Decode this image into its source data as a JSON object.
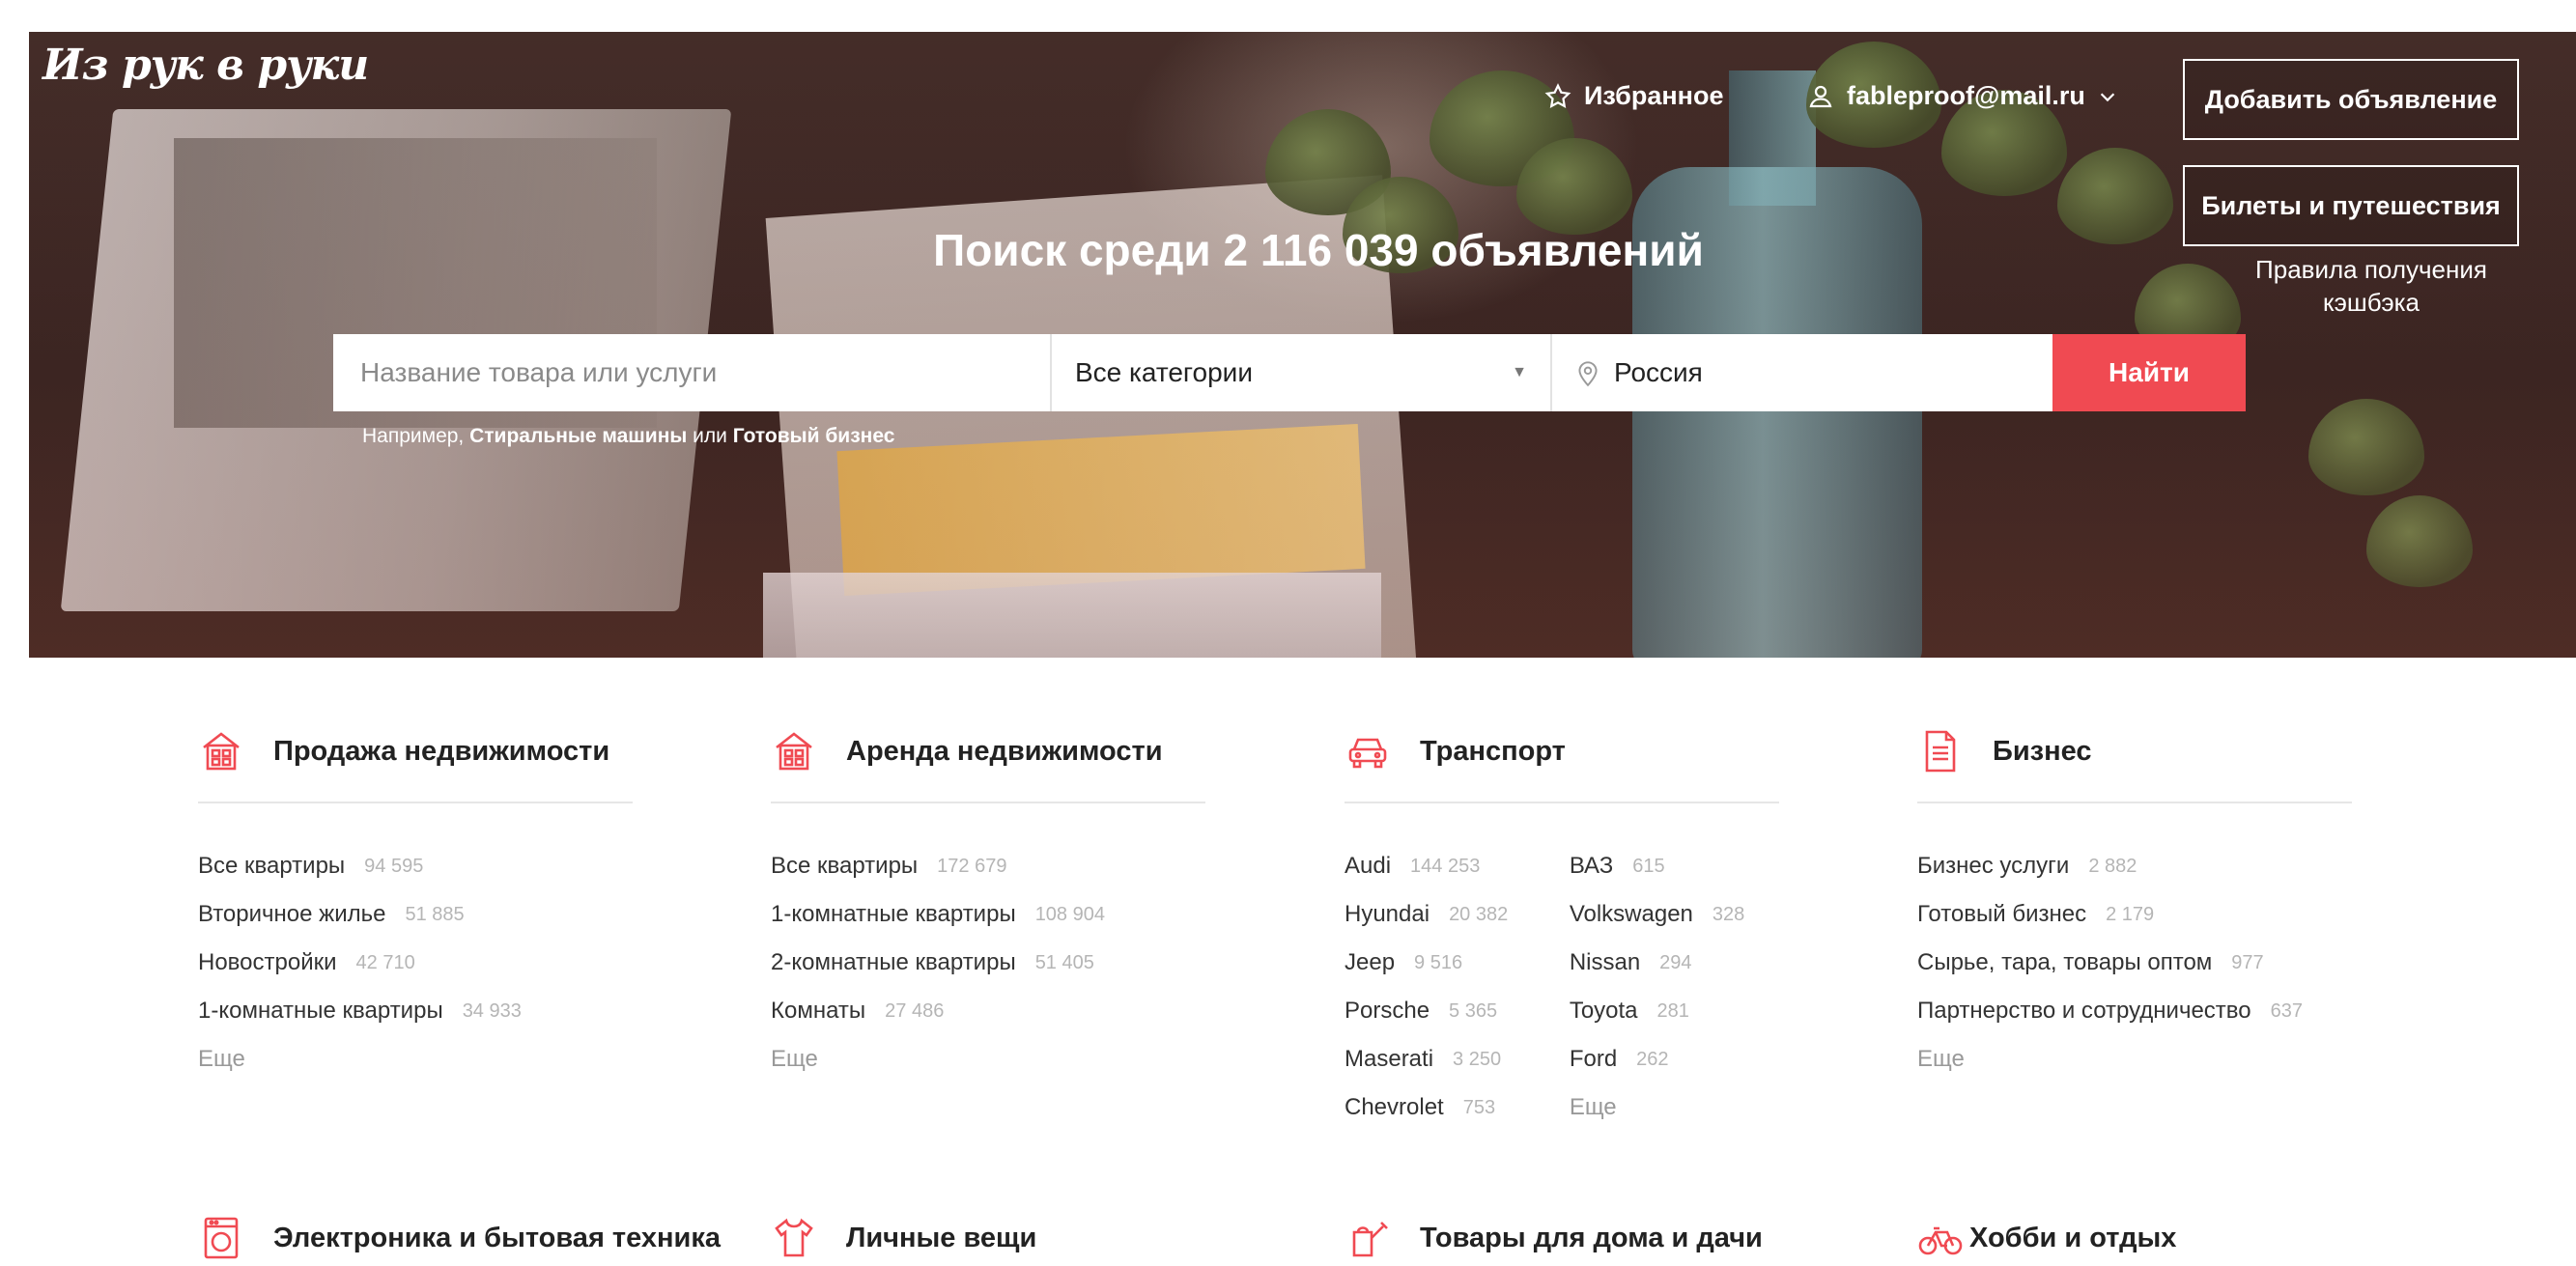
{
  "header": {
    "logo": "Из рук в руки",
    "favorites_label": "Избранное",
    "user_email": "fableproof@mail.ru",
    "add_listing_label": "Добавить объявление",
    "tickets_label": "Билеты и путешествия",
    "cashback_label": "Правила получения кэшбэка"
  },
  "hero": {
    "title": "Поиск среди 2 116 039 объявлений"
  },
  "search": {
    "placeholder": "Название товара или услуги",
    "category_value": "Все категории",
    "location_value": "Россия",
    "submit_label": "Найти",
    "example_prefix": "Например,",
    "example_1": "Стиральные машины",
    "example_or": "или",
    "example_2": "Готовый бизнес"
  },
  "colors": {
    "accent": "#f04a52",
    "icon": "#f04a52"
  },
  "categories": [
    {
      "title": "Продажа недвижимости",
      "icon": "house-icon",
      "items": [
        {
          "label": "Все квартиры",
          "count": "94 595"
        },
        {
          "label": "Вторичное жилье",
          "count": "51 885"
        },
        {
          "label": "Новостройки",
          "count": "42 710"
        },
        {
          "label": "1-комнатные квартиры",
          "count": "34 933"
        }
      ],
      "more": "Еще"
    },
    {
      "title": "Аренда недвижимости",
      "icon": "house-icon",
      "items": [
        {
          "label": "Все квартиры",
          "count": "172 679"
        },
        {
          "label": "1-комнатные квартиры",
          "count": "108 904"
        },
        {
          "label": "2-комнатные квартиры",
          "count": "51 405"
        },
        {
          "label": "Комнаты",
          "count": "27 486"
        }
      ],
      "more": "Еще"
    },
    {
      "title": "Транспорт",
      "icon": "car-icon",
      "items_a": [
        {
          "label": "Audi",
          "count": "144 253"
        },
        {
          "label": "Hyundai",
          "count": "20 382"
        },
        {
          "label": "Jeep",
          "count": "9 516"
        },
        {
          "label": "Porsche",
          "count": "5 365"
        },
        {
          "label": "Maserati",
          "count": "3 250"
        },
        {
          "label": "Chevrolet",
          "count": "753"
        }
      ],
      "items_b": [
        {
          "label": "ВАЗ",
          "count": "615"
        },
        {
          "label": "Volkswagen",
          "count": "328"
        },
        {
          "label": "Nissan",
          "count": "294"
        },
        {
          "label": "Toyota",
          "count": "281"
        },
        {
          "label": "Ford",
          "count": "262"
        }
      ],
      "more": "Еще"
    },
    {
      "title": "Бизнес",
      "icon": "document-icon",
      "items": [
        {
          "label": "Бизнес услуги",
          "count": "2 882"
        },
        {
          "label": "Готовый бизнес",
          "count": "2 179"
        },
        {
          "label": "Сырье, тара, товары оптом",
          "count": "977"
        },
        {
          "label": "Партнерство и сотрудничество",
          "count": "637"
        }
      ],
      "more": "Еще"
    }
  ],
  "categories_row2": [
    {
      "title": "Электроника и бытовая техника",
      "icon": "washing-machine-icon"
    },
    {
      "title": "Личные вещи",
      "icon": "tshirt-icon"
    },
    {
      "title": "Товары для дома и дачи",
      "icon": "watering-can-icon"
    },
    {
      "title": "Хобби и отдых",
      "icon": "bicycle-icon"
    }
  ]
}
